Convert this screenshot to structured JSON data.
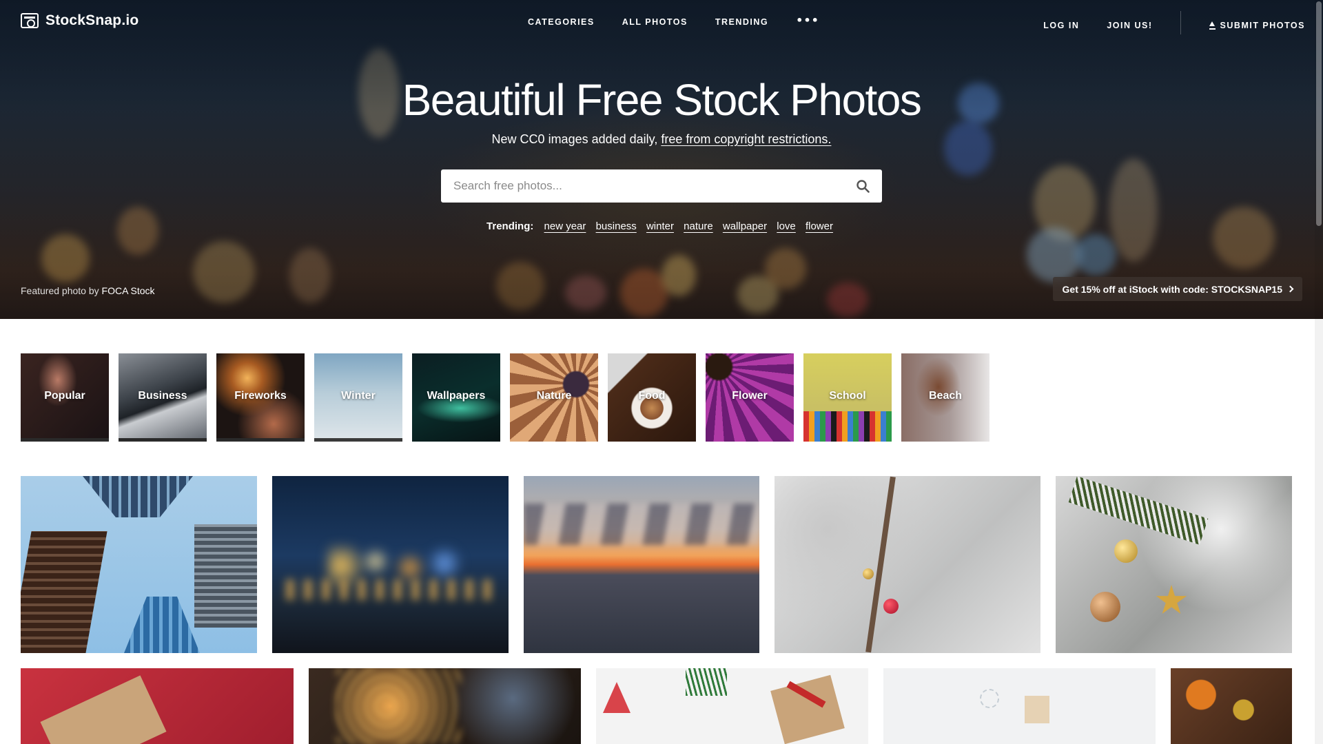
{
  "brand": {
    "name": "StockSnap.io"
  },
  "nav": {
    "center": [
      "CATEGORIES",
      "ALL PHOTOS",
      "TRENDING"
    ],
    "more": "•••",
    "login": "LOG IN",
    "join": "JOIN US!",
    "submit": "SUBMIT PHOTOS"
  },
  "hero": {
    "title": "Beautiful Free Stock Photos",
    "subtitle_prefix": "New CC0 images added daily,",
    "subtitle_link": "free from copyright restrictions.",
    "search_placeholder": "Search free photos...",
    "trending_label": "Trending:",
    "trending_tags": [
      "new year",
      "business",
      "winter",
      "nature",
      "wallpaper",
      "love",
      "flower"
    ],
    "credit_prefix": "Featured photo by",
    "credit_name": "FOCA Stock",
    "promo": "Get 15% off at iStock with code: STOCKSNAP15"
  },
  "categories": [
    {
      "label": "Popular"
    },
    {
      "label": "Business"
    },
    {
      "label": "Fireworks"
    },
    {
      "label": "Winter"
    },
    {
      "label": "Wallpapers"
    },
    {
      "label": "Nature"
    },
    {
      "label": "Food"
    },
    {
      "label": "Flower"
    },
    {
      "label": "School"
    },
    {
      "label": "Beach"
    }
  ],
  "photos": [
    {
      "subject": "skyscrapers looking up"
    },
    {
      "subject": "city lights bokeh at night"
    },
    {
      "subject": "ocean sunset"
    },
    {
      "subject": "snowy tree with ornaments"
    },
    {
      "subject": "snowy pine branch with ornaments"
    },
    {
      "subject": "wrapped gift on red"
    },
    {
      "subject": "christmas tree lights"
    },
    {
      "subject": "gifts and pine sprigs on white"
    },
    {
      "subject": "snowflake ornament and small gift"
    },
    {
      "subject": "autumn pumpkins"
    }
  ]
}
